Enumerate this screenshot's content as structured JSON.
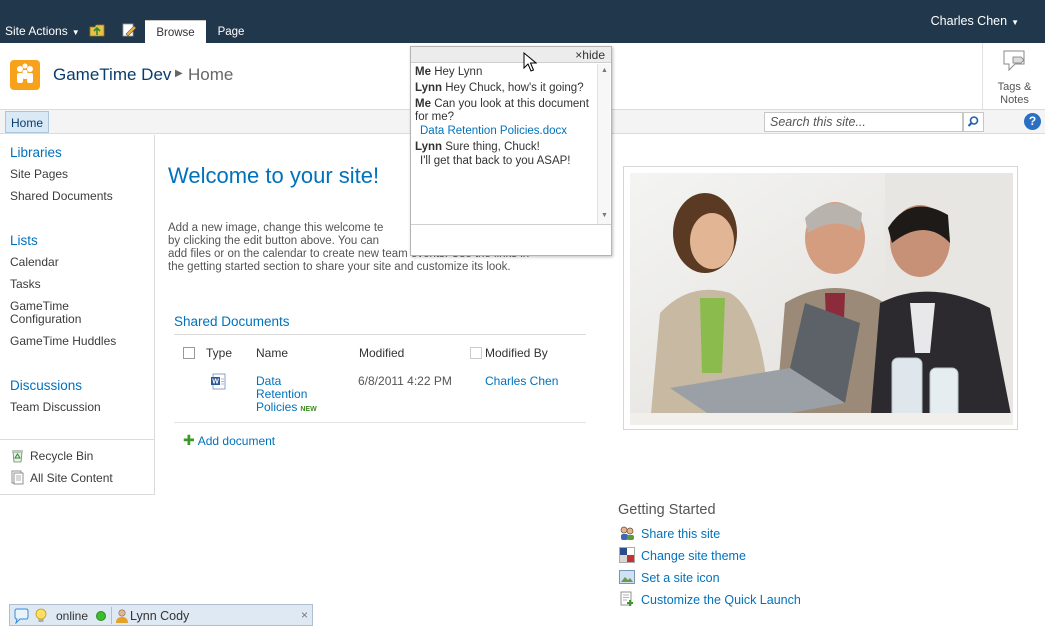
{
  "topbar": {
    "site_actions": "Site Actions",
    "tabs": [
      "Browse",
      "Page"
    ],
    "user": "Charles Chen"
  },
  "title_area": {
    "site_title": "GameTime Dev",
    "breadcrumb_current": "Home",
    "tags_notes_label_line1": "Tags &",
    "tags_notes_label_line2": "Notes"
  },
  "topnav": {
    "home": "Home",
    "search_placeholder": "Search this site...",
    "help": "?"
  },
  "quicklaunch": {
    "libraries_heading": "Libraries",
    "libraries": [
      "Site Pages",
      "Shared Documents"
    ],
    "lists_heading": "Lists",
    "lists": [
      "Calendar",
      "Tasks",
      "GameTime",
      "Configuration",
      "GameTime Huddles"
    ],
    "discussions_heading": "Discussions",
    "discussions": [
      "Team Discussion"
    ],
    "recycle_bin": "Recycle Bin",
    "all_site_content": "All Site Content"
  },
  "main": {
    "welcome_title": "Welcome to your site!",
    "welcome_text_1": "Add a new image, change this welcome te",
    "welcome_text_2": "by clicking the edit button above. You can",
    "welcome_text_3": "add files or on the calendar to create new team events. Use the links in",
    "welcome_text_4": "the getting started section to share your site and customize its look.",
    "docs_title": "Shared Documents",
    "columns": [
      "Type",
      "Name",
      "Modified",
      "Modified By"
    ],
    "row": {
      "name_1": "Data",
      "name_2": "Retention",
      "name_3": "Policies",
      "new_badge": "NEW",
      "modified": "6/8/2011 4:22 PM",
      "modified_by": "Charles Chen"
    },
    "add_document": "Add document"
  },
  "getting_started": {
    "title": "Getting Started",
    "links": [
      "Share this site",
      "Change site theme",
      "Set a site icon",
      "Customize the Quick Launch"
    ]
  },
  "chat": {
    "hide": "×hide",
    "messages": [
      {
        "from": "Me",
        "text": "Hey Lynn"
      },
      {
        "from": "Lynn",
        "text": "Hey Chuck, how's it going?"
      },
      {
        "from": "Me",
        "text": "Can you look at this document for me?"
      },
      {
        "link": "Data Retention Policies.docx"
      },
      {
        "from": "Lynn",
        "text": "Sure thing, Chuck!"
      },
      {
        "text": "I'll get that back to you ASAP!"
      }
    ]
  },
  "statusbar": {
    "status": "online",
    "contact": "Lynn Cody",
    "close": "×"
  },
  "colors": {
    "ribbon": "#21374c",
    "link_blue": "#0072bc",
    "online_green": "#3cbd2b"
  }
}
